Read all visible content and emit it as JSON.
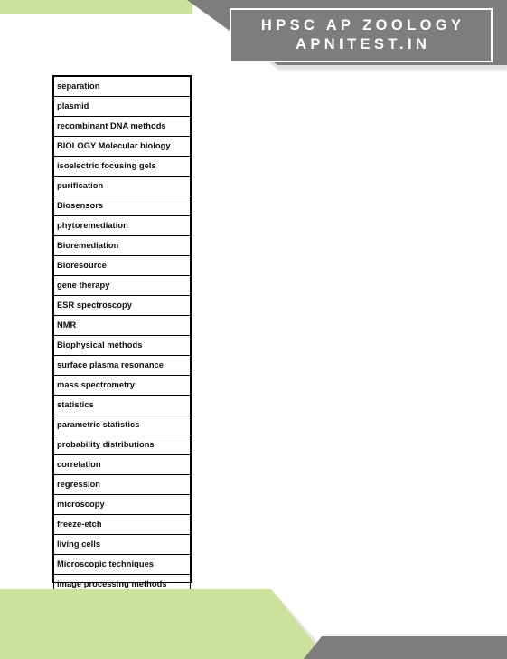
{
  "slide": {
    "background_color": "#ffffff",
    "accent_green": "#cbe29c",
    "accent_gray": "#7d7d7d",
    "border_color": "#000000"
  },
  "header": {
    "title_line_1": "HPSC AP ZOOLOGY",
    "title_line_2": "APNITEST.IN",
    "box_background": "#7d7d7d",
    "box_border": "#ffffff",
    "text_color": "#ffffff"
  },
  "topics": [
    {
      "label": "separation"
    },
    {
      "label": "plasmid"
    },
    {
      "label": "recombinant DNA methods"
    },
    {
      "label": "BIOLOGY Molecular biology"
    },
    {
      "label": "isoelectric focusing gels"
    },
    {
      "label": "purification"
    },
    {
      "label": "Biosensors"
    },
    {
      "label": "phytoremediation"
    },
    {
      "label": "Bioremediation"
    },
    {
      "label": "Bioresource"
    },
    {
      "label": "gene therapy"
    },
    {
      "label": "ESR spectroscopy"
    },
    {
      "label": "NMR"
    },
    {
      "label": "Biophysical methods"
    },
    {
      "label": "surface plasma resonance"
    },
    {
      "label": "mass spectrometry"
    },
    {
      "label": "statistics"
    },
    {
      "label": "parametric statistics"
    },
    {
      "label": "probability distributions"
    },
    {
      "label": "correlation"
    },
    {
      "label": "regression"
    },
    {
      "label": "microscopy"
    },
    {
      "label": "freeze-etch"
    },
    {
      "label": "living cells"
    },
    {
      "label": "Microscopic techniques"
    },
    {
      "label": "image processing methods"
    }
  ]
}
